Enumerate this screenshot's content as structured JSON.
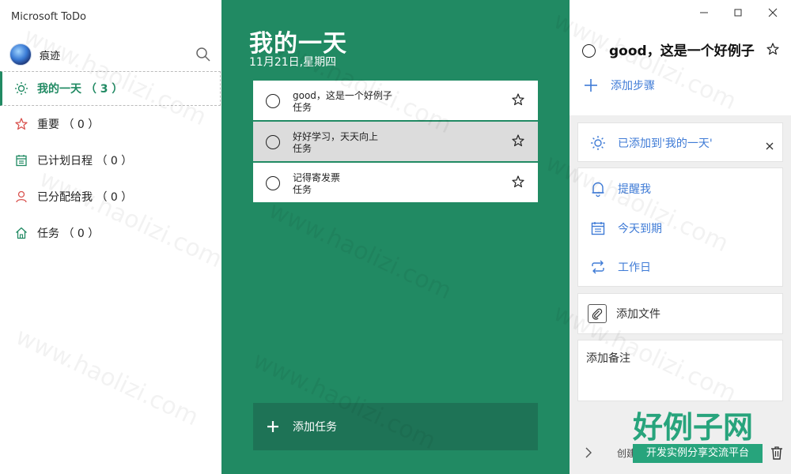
{
  "app": {
    "title": "Microsoft ToDo"
  },
  "user": {
    "name": "痕迹"
  },
  "sidebar": {
    "items": [
      {
        "label": "我的一天 （ 3 ）",
        "icon": "sun-icon",
        "active": true
      },
      {
        "label": "重要 （ 0 ）",
        "icon": "star-icon",
        "active": false
      },
      {
        "label": "已计划日程 （ 0 ）",
        "icon": "calendar-icon",
        "active": false
      },
      {
        "label": "已分配给我 （ 0 ）",
        "icon": "person-icon",
        "active": false
      },
      {
        "label": "任务 （ 0 ）",
        "icon": "home-icon",
        "active": false
      }
    ]
  },
  "main": {
    "title": "我的一天",
    "date": "11月21日,星期四",
    "tasks": [
      {
        "title": "good，这是一个好例子",
        "subtitle": "任务"
      },
      {
        "title": "好好学习，天天向上",
        "subtitle": "任务"
      },
      {
        "title": "记得寄发票",
        "subtitle": "任务"
      }
    ],
    "add_task_label": "添加任务"
  },
  "detail": {
    "task_title": "good，这是一个好例子",
    "add_step_label": "添加步骤",
    "added_to_my_day_label": "已添加到'我的一天'",
    "remind_me_label": "提醒我",
    "due_today_label": "今天到期",
    "repeat_label": "工作日",
    "add_file_label": "添加文件",
    "add_note_label": "添加备注",
    "created_label": "创建于 一小时前"
  },
  "watermark": {
    "text": "www.haolizi.com",
    "logo_big": "好例子网",
    "logo_small": "开发实例分享交流平台"
  },
  "colors": {
    "accent": "#218a63",
    "link": "#3f7bd6",
    "add_task_bg": "#1e7356"
  }
}
